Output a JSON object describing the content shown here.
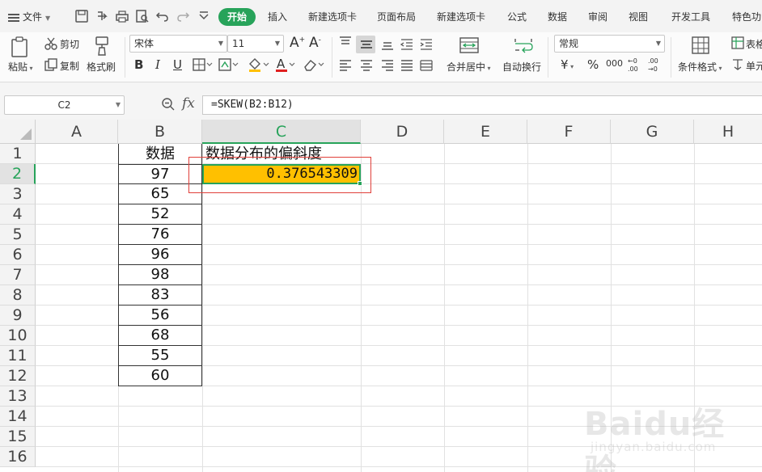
{
  "menubar": {
    "file_label": "文件",
    "active_tab": "开始",
    "tabs": [
      "插入",
      "新建选项卡",
      "页面布局",
      "新建选项卡",
      "公式",
      "数据",
      "审阅",
      "视图",
      "开发工具",
      "特色功"
    ]
  },
  "ribbon": {
    "paste_label": "粘贴",
    "cut_label": "剪切",
    "copy_label": "复制",
    "format_painter_label": "格式刷",
    "font_name": "宋体",
    "font_size": "11",
    "bold_label": "B",
    "italic_label": "I",
    "underline_label": "U",
    "merge_center_label": "合并居中",
    "wrap_text_label": "自动换行",
    "number_format": "常规",
    "currency_label": "¥",
    "percent_label": "%",
    "thousands_label": "000",
    "conditional_format_label": "条件格式",
    "table_style_label": "表格",
    "cell_label": "单元"
  },
  "formula_bar": {
    "name_box": "C2",
    "fx_label": "fx",
    "formula": "=SKEW(B2:B12)"
  },
  "grid": {
    "columns": [
      "A",
      "B",
      "C",
      "D",
      "E",
      "F",
      "G",
      "H"
    ],
    "active_column": "C",
    "rows": [
      "1",
      "2",
      "3",
      "4",
      "5",
      "6",
      "7",
      "8",
      "9",
      "10",
      "11",
      "12",
      "13",
      "14",
      "15",
      "16"
    ],
    "active_row": "2",
    "b1_header": "数据",
    "c1_header": "数据分布的偏斜度",
    "b_values": [
      "97",
      "65",
      "52",
      "76",
      "96",
      "98",
      "83",
      "56",
      "68",
      "55",
      "60"
    ],
    "c2_result": "0.376543309"
  },
  "colors": {
    "accent": "#27a35a",
    "highlight": "#ffc000",
    "annotation": "#e0403a"
  },
  "watermark": {
    "brand": "Baidu经验",
    "url": "jingyan.baidu.com"
  }
}
